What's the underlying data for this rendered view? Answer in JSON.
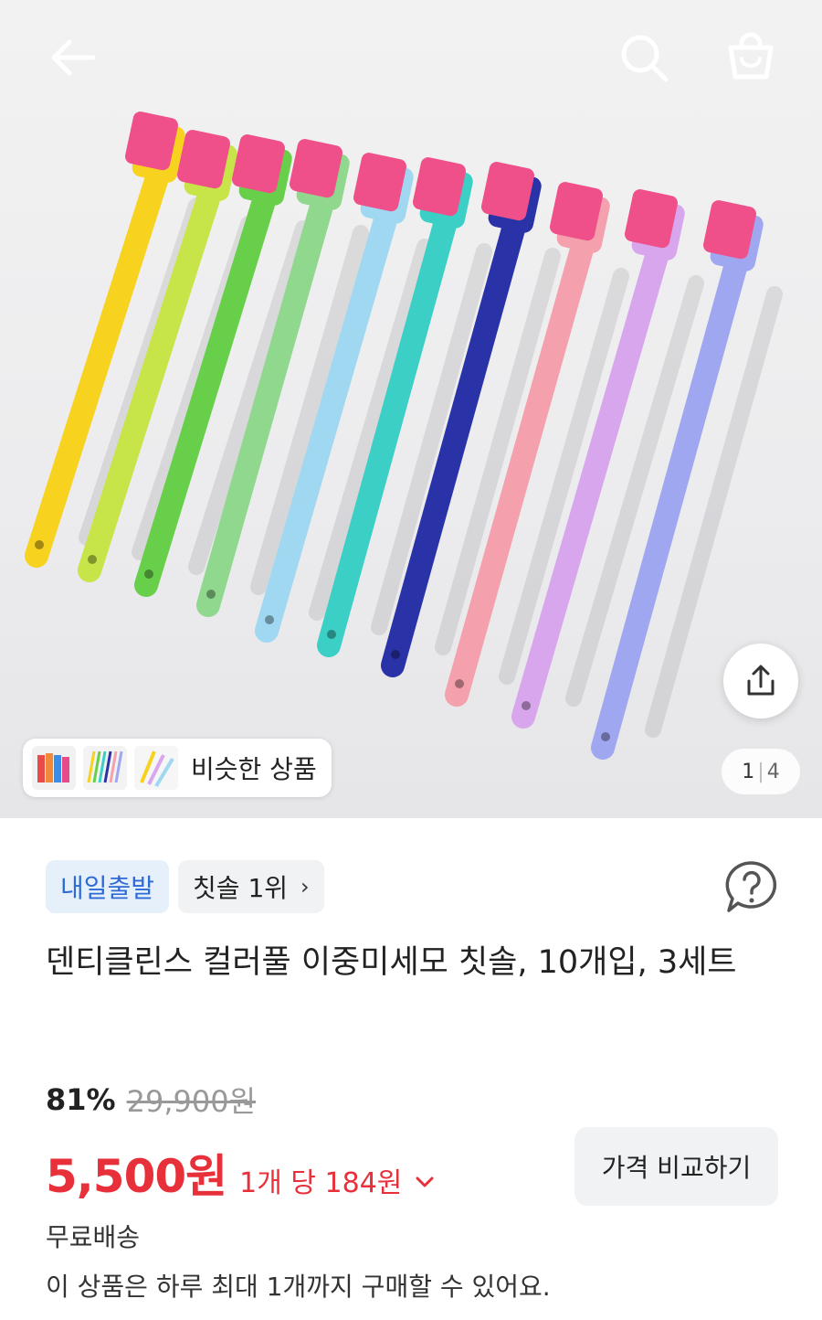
{
  "hero": {
    "image_icon": "toothbrush-photo",
    "back_icon": "arrow-left-icon",
    "search_icon": "search-icon",
    "cart_icon": "shopping-bag-icon",
    "share_icon": "share-icon",
    "brush_colors": [
      "#f7d21e",
      "#c7e548",
      "#68cf4a",
      "#8fd88e",
      "#9fd8f0",
      "#3ccfc6",
      "#2a32a8",
      "#f4a0ad",
      "#d8a6ec",
      "#9fa7f0"
    ],
    "bristle_color": "#f0508a",
    "similar_label": "비슷한 상품",
    "page_current": "1",
    "page_total": "4"
  },
  "badges": {
    "delivery": "내일출발",
    "rank": "칫솔 1위",
    "rank_chevron": "›"
  },
  "product": {
    "title": "덴티클린스 컬러풀 이중미세모 칫솔, 10개입, 3세트",
    "discount": "81%",
    "original_price": "29,900원",
    "price": "5,500원",
    "unit_price": "1개 당 184원",
    "compare_label": "가격 비교하기",
    "shipping": "무료배송",
    "purchase_limit": "이 상품은 하루 최대 1개까지 구매할 수 있어요."
  },
  "colors": {
    "price_red": "#e8303a",
    "badge_blue": "#2e6ad6"
  }
}
